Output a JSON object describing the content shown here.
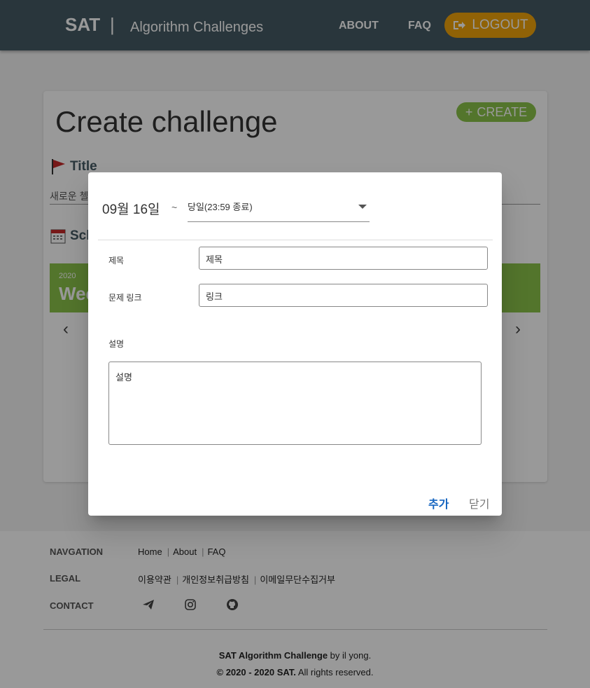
{
  "header": {
    "brand": "SAT",
    "separator": "|",
    "subtitle": "Algorithm Challenges",
    "nav": {
      "about": "ABOUT",
      "faq": "FAQ",
      "logout": "LOGOUT"
    }
  },
  "page": {
    "title": "Create challenge",
    "create_button": "CREATE",
    "title_section": "Title",
    "title_placeholder": "새로운 첼",
    "schedule_section": "Sch",
    "week_year": "2020",
    "week_label": "Wee"
  },
  "dialog": {
    "date": "09월 16일",
    "tilde": "~",
    "end_select_value": "당일(23:59 종료)",
    "title_label": "제목",
    "title_value": "제목",
    "link_label": "문제 링크",
    "link_value": "링크",
    "desc_label": "설명",
    "desc_value": "설명",
    "add_button": "추가",
    "close_button": "닫기"
  },
  "footer": {
    "nav_label": "NAVGATION",
    "nav_links": [
      "Home",
      "About",
      "FAQ"
    ],
    "legal_label": "LEGAL",
    "legal_links": [
      "이용약관",
      "개인정보취급방침",
      "이메일무단수집거부"
    ],
    "contact_label": "CONTACT",
    "contact_icons": [
      "telegram-icon",
      "instagram-icon",
      "github-icon"
    ],
    "credit_bold": "SAT Algorithm Challenge",
    "credit_rest": " by il yong.",
    "copyright_bold": "© 2020 - 2020 SAT.",
    "copyright_rest": " All rights reserved."
  },
  "colors": {
    "header_bg": "#455a64",
    "logout_bg": "#f0a30a",
    "accent_green": "#8bc34a",
    "add_blue": "#1565c0"
  }
}
